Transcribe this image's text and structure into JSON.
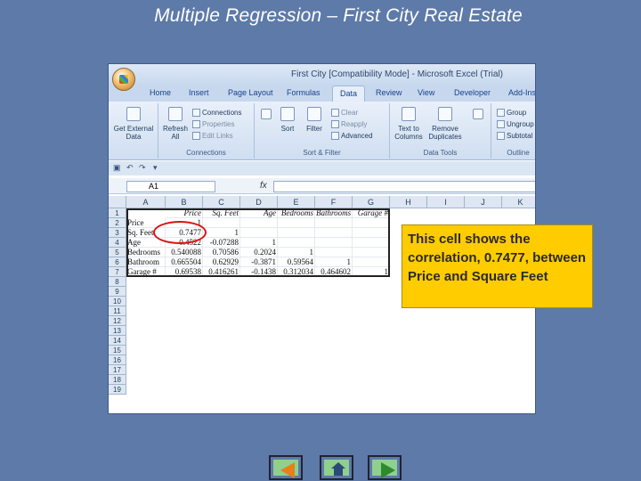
{
  "slide": {
    "title": "Multiple Regression – First City Real Estate",
    "callout": "This cell shows the correlation, 0.7477, between Price and Square Feet"
  },
  "excel": {
    "window_title": "First City [Compatibility Mode] - Microsoft Excel (Trial)",
    "tabs": [
      "Home",
      "Insert",
      "Page Layout",
      "Formulas",
      "Data",
      "Review",
      "View",
      "Developer",
      "Add-Ins"
    ],
    "active_tab": "Data",
    "ribbon": {
      "get_external_data": "Get External Data",
      "refresh_all": "Refresh All",
      "connections": "Connections",
      "properties": "Properties",
      "edit_links": "Edit Links",
      "connections_group": "Connections",
      "sort": "Sort",
      "filter": "Filter",
      "clear": "Clear",
      "reapply": "Reapply",
      "advanced": "Advanced",
      "sort_filter_group": "Sort & Filter",
      "text_to_columns": "Text to Columns",
      "remove_duplicates": "Remove Duplicates",
      "data_tools_group": "Data Tools",
      "group": "Group",
      "ungroup": "Ungroup",
      "subtotal": "Subtotal",
      "outline_group": "Outline"
    },
    "name_box": "A1",
    "fx_label": "fx",
    "columns": [
      "A",
      "B",
      "C",
      "D",
      "E",
      "F",
      "G",
      "H",
      "I",
      "J",
      "K"
    ],
    "rows": [
      "1",
      "2",
      "3",
      "4",
      "5",
      "6",
      "7",
      "8",
      "9",
      "10",
      "11",
      "12",
      "13",
      "14",
      "15",
      "16",
      "17",
      "18",
      "19"
    ],
    "headers": [
      "Price",
      "Sq. Feet",
      "Age",
      "Bedrooms",
      "Bathrooms",
      "Garage #"
    ],
    "table": [
      [
        "Price",
        "1",
        "",
        "",
        "",
        "",
        ""
      ],
      [
        "Sq. Feet",
        "0.7477",
        "1",
        "",
        "",
        "",
        ""
      ],
      [
        "Age",
        "-0.4522",
        "-0.07288",
        "1",
        "",
        "",
        ""
      ],
      [
        "Bedrooms",
        "0.540088",
        "0.70586",
        "0.2024",
        "1",
        "",
        ""
      ],
      [
        "Bathroom",
        "0.665504",
        "0.62929",
        "-0.3871",
        "0.59564",
        "1",
        ""
      ],
      [
        "Garage #",
        "0.69538",
        "0.416261",
        "-0.1438",
        "0.312034",
        "0.464602",
        "1"
      ]
    ]
  },
  "nav": {
    "prev": "previous-slide",
    "home": "home",
    "next": "next-slide"
  }
}
